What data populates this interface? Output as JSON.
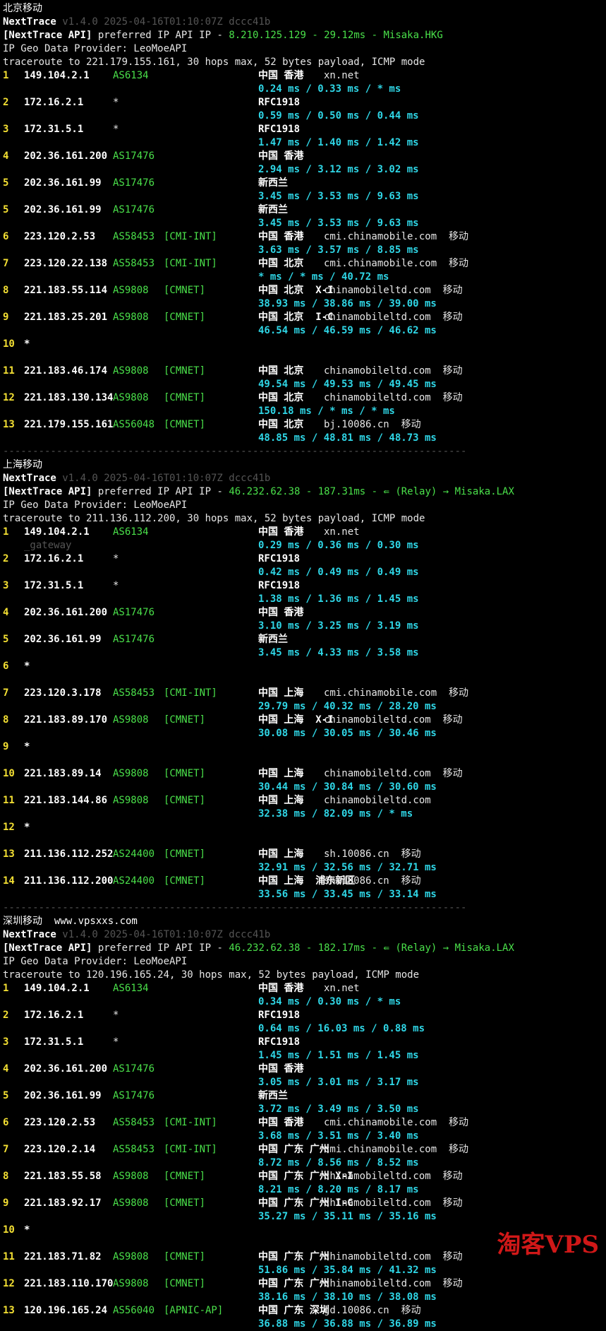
{
  "colors": {
    "background": "#000000",
    "hop": "#f4e033",
    "asn": "#4ae04a",
    "rtt": "#2fd6e6",
    "watermark": "#d01818"
  },
  "sections": [
    {
      "title": "北京移动",
      "version": "v1.4.0 2025-04-16T01:10:07Z dccc41b",
      "api": {
        "ip": "8.210.125.129",
        "latency": "29.12ms",
        "via": "",
        "node": "Misaka.HKG"
      },
      "provider": "IP Geo Data Provider: LeoMoeAPI",
      "traceroute": "traceroute to 221.179.155.161, 30 hops max, 52 bytes payload, ICMP mode",
      "hops": [
        {
          "n": "1",
          "ip": "149.104.2.1",
          "as": "AS6134",
          "tag": "",
          "geo": "中国 香港",
          "host": "xn.net",
          "rtt": "0.24 ms / 0.33 ms / * ms"
        },
        {
          "n": "2",
          "ip": "172.16.2.1",
          "as": "*",
          "tag": "",
          "geo": "RFC1918",
          "host": "",
          "rtt": "0.59 ms / 0.50 ms / 0.44 ms"
        },
        {
          "n": "3",
          "ip": "172.31.5.1",
          "as": "*",
          "tag": "",
          "geo": "RFC1918",
          "host": "",
          "rtt": "1.47 ms / 1.40 ms / 1.42 ms"
        },
        {
          "n": "4",
          "ip": "202.36.161.200",
          "as": "AS17476",
          "tag": "",
          "geo": "中国 香港",
          "host": "",
          "rtt": "2.94 ms / 3.12 ms / 3.02 ms"
        },
        {
          "n": "5",
          "ip": "202.36.161.99",
          "as": "AS17476",
          "tag": "",
          "geo": "新西兰",
          "host": "",
          "rtt": "3.45 ms / 3.53 ms / 9.63 ms"
        },
        {
          "n": "5",
          "ip": "202.36.161.99",
          "as": "AS17476",
          "tag": "",
          "geo": "新西兰",
          "host": "",
          "rtt": "3.45 ms / 3.53 ms / 9.63 ms"
        },
        {
          "n": "6",
          "ip": "223.120.2.53",
          "as": "AS58453",
          "tag": "[CMI-INT]",
          "geo": "中国 香港",
          "host": "cmi.chinamobile.com  移动",
          "rtt": "3.63 ms / 3.57 ms / 8.85 ms"
        },
        {
          "n": "7",
          "ip": "223.120.22.138",
          "as": "AS58453",
          "tag": "[CMI-INT]",
          "geo": "中国 北京",
          "host": "cmi.chinamobile.com  移动",
          "rtt": "* ms / * ms / 40.72 ms"
        },
        {
          "n": "8",
          "ip": "221.183.55.114",
          "as": "AS9808",
          "tag": "[CMNET]",
          "geo": "中国 北京  X-I",
          "host": "chinamobileltd.com  移动",
          "rtt": "38.93 ms / 38.86 ms / 39.00 ms"
        },
        {
          "n": "9",
          "ip": "221.183.25.201",
          "as": "AS9808",
          "tag": "[CMNET]",
          "geo": "中国 北京  I-C",
          "host": "chinamobileltd.com  移动",
          "rtt": "46.54 ms / 46.59 ms / 46.62 ms"
        },
        {
          "n": "10",
          "ip": "*",
          "as": "",
          "tag": "",
          "geo": "",
          "host": "",
          "rtt": ""
        },
        {
          "n": "11",
          "ip": "221.183.46.174",
          "as": "AS9808",
          "tag": "[CMNET]",
          "geo": "中国 北京",
          "host": "chinamobileltd.com  移动",
          "rtt": "49.54 ms / 49.53 ms / 49.45 ms"
        },
        {
          "n": "12",
          "ip": "221.183.130.134",
          "as": "AS9808",
          "tag": "[CMNET]",
          "geo": "中国 北京",
          "host": "chinamobileltd.com  移动",
          "rtt": "150.18 ms / * ms / * ms"
        },
        {
          "n": "13",
          "ip": "221.179.155.161",
          "as": "AS56048",
          "tag": "[CMNET]",
          "geo": "中国 北京",
          "host": "bj.10086.cn  移动",
          "rtt": "48.85 ms / 48.81 ms / 48.73 ms"
        }
      ]
    },
    {
      "title": "上海移动",
      "version": "v1.4.0 2025-04-16T01:10:07Z dccc41b",
      "api": {
        "ip": "46.232.62.38",
        "latency": "187.31ms",
        "via": "(Relay)",
        "node": "Misaka.LAX"
      },
      "provider": "IP Geo Data Provider: LeoMoeAPI",
      "traceroute": "traceroute to 211.136.112.200, 30 hops max, 52 bytes payload, ICMP mode",
      "hops": [
        {
          "n": "1",
          "ip": "149.104.2.1",
          "as": "AS6134",
          "tag": "",
          "geo": "中国 香港",
          "host": "xn.net",
          "rtt": "0.29 ms / 0.36 ms / 0.30 ms",
          "sub": "_gateway"
        },
        {
          "n": "2",
          "ip": "172.16.2.1",
          "as": "*",
          "tag": "",
          "geo": "RFC1918",
          "host": "",
          "rtt": "0.42 ms / 0.49 ms / 0.49 ms"
        },
        {
          "n": "3",
          "ip": "172.31.5.1",
          "as": "*",
          "tag": "",
          "geo": "RFC1918",
          "host": "",
          "rtt": "1.38 ms / 1.36 ms / 1.45 ms"
        },
        {
          "n": "4",
          "ip": "202.36.161.200",
          "as": "AS17476",
          "tag": "",
          "geo": "中国 香港",
          "host": "",
          "rtt": "3.10 ms / 3.25 ms / 3.19 ms"
        },
        {
          "n": "5",
          "ip": "202.36.161.99",
          "as": "AS17476",
          "tag": "",
          "geo": "新西兰",
          "host": "",
          "rtt": "3.45 ms / 4.33 ms / 3.58 ms"
        },
        {
          "n": "6",
          "ip": "*",
          "as": "",
          "tag": "",
          "geo": "",
          "host": "",
          "rtt": ""
        },
        {
          "n": "7",
          "ip": "223.120.3.178",
          "as": "AS58453",
          "tag": "[CMI-INT]",
          "geo": "中国 上海",
          "host": "cmi.chinamobile.com  移动",
          "rtt": "29.79 ms / 40.32 ms / 28.20 ms"
        },
        {
          "n": "8",
          "ip": "221.183.89.170",
          "as": "AS9808",
          "tag": "[CMNET]",
          "geo": "中国 上海  X-I",
          "host": "chinamobileltd.com  移动",
          "rtt": "30.08 ms / 30.05 ms / 30.46 ms"
        },
        {
          "n": "9",
          "ip": "*",
          "as": "",
          "tag": "",
          "geo": "",
          "host": "",
          "rtt": ""
        },
        {
          "n": "10",
          "ip": "221.183.89.14",
          "as": "AS9808",
          "tag": "[CMNET]",
          "geo": "中国 上海",
          "host": "chinamobileltd.com  移动",
          "rtt": "30.44 ms / 30.84 ms / 30.60 ms"
        },
        {
          "n": "11",
          "ip": "221.183.144.86",
          "as": "AS9808",
          "tag": "[CMNET]",
          "geo": "中国 上海",
          "host": "chinamobileltd.com",
          "rtt": "32.38 ms / 82.09 ms / * ms"
        },
        {
          "n": "12",
          "ip": "*",
          "as": "",
          "tag": "",
          "geo": "",
          "host": "",
          "rtt": ""
        },
        {
          "n": "13",
          "ip": "211.136.112.252",
          "as": "AS24400",
          "tag": "[CMNET]",
          "geo": "中国 上海",
          "host": "sh.10086.cn  移动",
          "rtt": "32.91 ms / 32.56 ms / 32.71 ms"
        },
        {
          "n": "14",
          "ip": "211.136.112.200",
          "as": "AS24400",
          "tag": "[CMNET]",
          "geo": "中国 上海  浦东新区",
          "host": "sh.10086.cn  移动",
          "rtt": "33.56 ms / 33.45 ms / 33.14 ms"
        }
      ]
    },
    {
      "title": "深圳移动",
      "title_extra": "www.vpsxxs.com",
      "version": "v1.4.0 2025-04-16T01:10:07Z dccc41b",
      "api": {
        "ip": "46.232.62.38",
        "latency": "182.17ms",
        "via": "(Relay)",
        "node": "Misaka.LAX"
      },
      "provider": "IP Geo Data Provider: LeoMoeAPI",
      "traceroute": "traceroute to 120.196.165.24, 30 hops max, 52 bytes payload, ICMP mode",
      "hops": [
        {
          "n": "1",
          "ip": "149.104.2.1",
          "as": "AS6134",
          "tag": "",
          "geo": "中国 香港",
          "host": "xn.net",
          "rtt": "0.34 ms / 0.30 ms / * ms"
        },
        {
          "n": "2",
          "ip": "172.16.2.1",
          "as": "*",
          "tag": "",
          "geo": "RFC1918",
          "host": "",
          "rtt": "0.64 ms / 16.03 ms / 0.88 ms"
        },
        {
          "n": "3",
          "ip": "172.31.5.1",
          "as": "*",
          "tag": "",
          "geo": "RFC1918",
          "host": "",
          "rtt": "1.45 ms / 1.51 ms / 1.45 ms"
        },
        {
          "n": "4",
          "ip": "202.36.161.200",
          "as": "AS17476",
          "tag": "",
          "geo": "中国 香港",
          "host": "",
          "rtt": "3.05 ms / 3.01 ms / 3.17 ms"
        },
        {
          "n": "5",
          "ip": "202.36.161.99",
          "as": "AS17476",
          "tag": "",
          "geo": "新西兰",
          "host": "",
          "rtt": "3.72 ms / 3.49 ms / 3.50 ms"
        },
        {
          "n": "6",
          "ip": "223.120.2.53",
          "as": "AS58453",
          "tag": "[CMI-INT]",
          "geo": "中国 香港",
          "host": "cmi.chinamobile.com  移动",
          "rtt": "3.68 ms / 3.51 ms / 3.40 ms"
        },
        {
          "n": "7",
          "ip": "223.120.2.14",
          "as": "AS58453",
          "tag": "[CMI-INT]",
          "geo": "中国 广东 广州",
          "host": "cmi.chinamobile.com  移动",
          "rtt": "8.72 ms / 8.56 ms / 8.52 ms"
        },
        {
          "n": "8",
          "ip": "221.183.55.58",
          "as": "AS9808",
          "tag": "[CMNET]",
          "geo": "中国 广东 广州 X-I",
          "host": "chinamobileltd.com  移动",
          "rtt": "8.21 ms / 8.20 ms / 8.17 ms"
        },
        {
          "n": "9",
          "ip": "221.183.92.17",
          "as": "AS9808",
          "tag": "[CMNET]",
          "geo": "中国 广东 广州 I-C",
          "host": "chinamobileltd.com  移动",
          "rtt": "35.27 ms / 35.11 ms / 35.16 ms"
        },
        {
          "n": "10",
          "ip": "*",
          "as": "",
          "tag": "",
          "geo": "",
          "host": "",
          "rtt": ""
        },
        {
          "n": "11",
          "ip": "221.183.71.82",
          "as": "AS9808",
          "tag": "[CMNET]",
          "geo": "中国 广东 广州",
          "host": "chinamobileltd.com  移动",
          "rtt": "51.86 ms / 35.84 ms / 41.32 ms"
        },
        {
          "n": "12",
          "ip": "221.183.110.170",
          "as": "AS9808",
          "tag": "[CMNET]",
          "geo": "中国 广东 广州",
          "host": "chinamobileltd.com  移动",
          "rtt": "38.16 ms / 38.10 ms / 38.08 ms"
        },
        {
          "n": "13",
          "ip": "120.196.165.24",
          "as": "AS56040",
          "tag": "[APNIC-AP]",
          "geo": "中国 广东 深圳",
          "host": "gd.10086.cn  移动",
          "rtt": "36.88 ms / 36.88 ms / 36.89 ms"
        }
      ]
    }
  ],
  "labels": {
    "app": "NextTrace",
    "api_prefix": "[NextTrace API]",
    "api_text": "preferred IP API IP -",
    "relay_icon": "⇚"
  },
  "watermark": "淘客VPS"
}
